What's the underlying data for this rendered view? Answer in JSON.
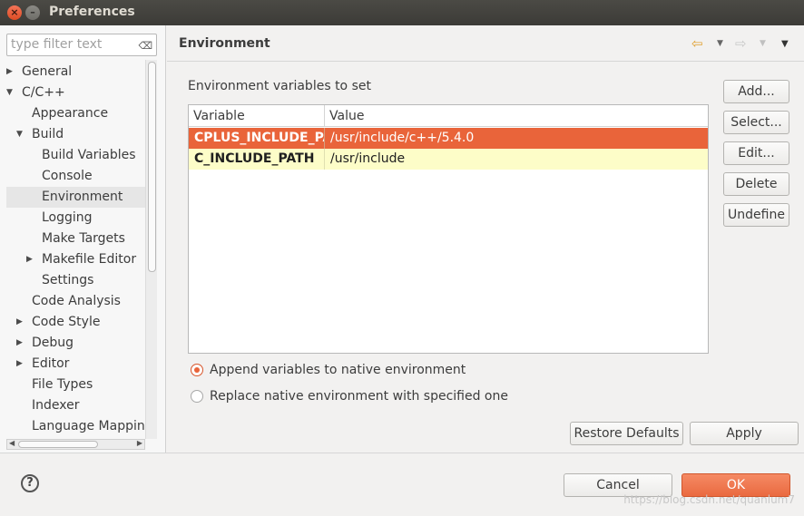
{
  "window": {
    "title": "Preferences"
  },
  "filter": {
    "placeholder": "type filter text"
  },
  "tree": [
    {
      "label": "General",
      "indent": 0,
      "twisty": "right",
      "selected": false
    },
    {
      "label": "C/C++",
      "indent": 0,
      "twisty": "down",
      "selected": false
    },
    {
      "label": "Appearance",
      "indent": 1,
      "twisty": "",
      "selected": false
    },
    {
      "label": "Build",
      "indent": 1,
      "twisty": "down",
      "selected": false
    },
    {
      "label": "Build Variables",
      "indent": 2,
      "twisty": "",
      "selected": false
    },
    {
      "label": "Console",
      "indent": 2,
      "twisty": "",
      "selected": false
    },
    {
      "label": "Environment",
      "indent": 2,
      "twisty": "",
      "selected": true
    },
    {
      "label": "Logging",
      "indent": 2,
      "twisty": "",
      "selected": false
    },
    {
      "label": "Make Targets",
      "indent": 2,
      "twisty": "",
      "selected": false
    },
    {
      "label": "Makefile Editor",
      "indent": 2,
      "twisty": "right",
      "selected": false
    },
    {
      "label": "Settings",
      "indent": 2,
      "twisty": "",
      "selected": false
    },
    {
      "label": "Code Analysis",
      "indent": 1,
      "twisty": "",
      "selected": false
    },
    {
      "label": "Code Style",
      "indent": 1,
      "twisty": "right",
      "selected": false
    },
    {
      "label": "Debug",
      "indent": 1,
      "twisty": "right",
      "selected": false
    },
    {
      "label": "Editor",
      "indent": 1,
      "twisty": "right",
      "selected": false
    },
    {
      "label": "File Types",
      "indent": 1,
      "twisty": "",
      "selected": false
    },
    {
      "label": "Indexer",
      "indent": 1,
      "twisty": "",
      "selected": false
    },
    {
      "label": "Language Mappings",
      "indent": 1,
      "twisty": "",
      "selected": false
    }
  ],
  "page": {
    "title": "Environment",
    "section_label": "Environment variables to set",
    "table": {
      "headers": [
        "Variable",
        "Value"
      ],
      "rows": [
        {
          "variable": "CPLUS_INCLUDE_PATH",
          "value": "/usr/include/c++/5.4.0"
        },
        {
          "variable": "C_INCLUDE_PATH",
          "value": "/usr/include"
        }
      ]
    },
    "buttons": {
      "add": "Add...",
      "select": "Select...",
      "edit": "Edit...",
      "delete": "Delete",
      "undefine": "Undefine"
    },
    "radios": {
      "append": "Append variables to native environment",
      "replace": "Replace native environment with specified one",
      "selected": "append"
    },
    "restore_defaults": "Restore Defaults",
    "apply": "Apply"
  },
  "footer": {
    "help": "?",
    "cancel": "Cancel",
    "ok": "OK",
    "watermark": "https://blog.csdn.net/quanlum7"
  },
  "colors": {
    "accent": "#e9643a",
    "highlight_row": "#fdfdc8",
    "nav_back": "#e8a33a"
  },
  "icons": {
    "back": "arrow-left-icon",
    "forward": "arrow-right-icon",
    "menu": "view-menu-icon"
  }
}
